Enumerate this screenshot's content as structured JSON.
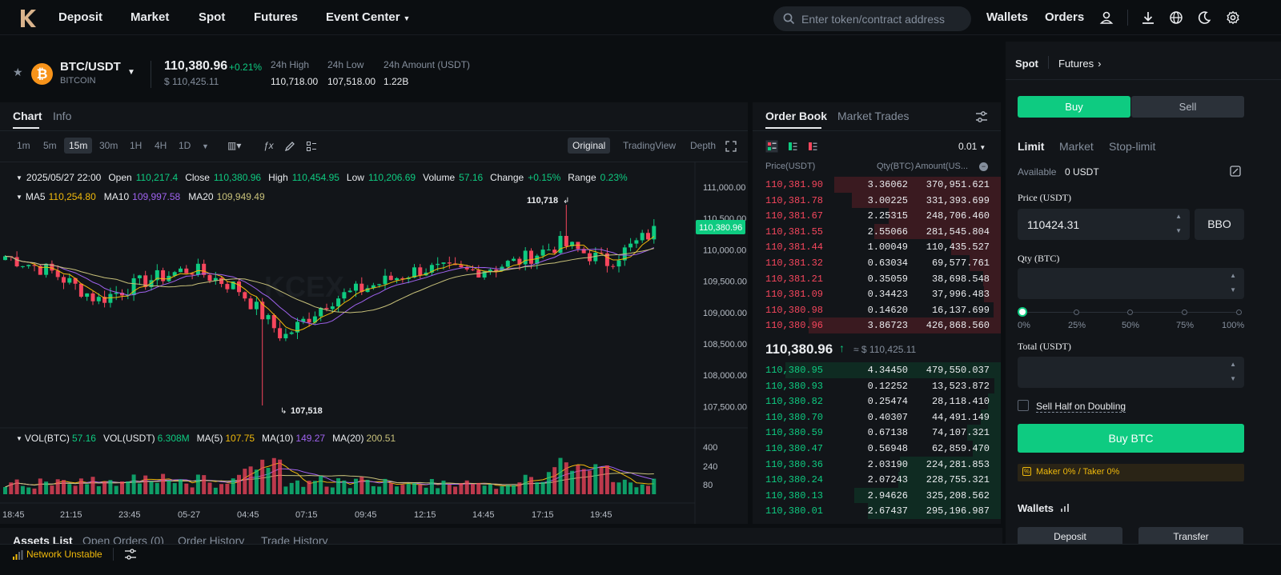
{
  "nav": {
    "links": [
      "Deposit",
      "Market",
      "Spot",
      "Futures",
      "Event Center"
    ],
    "search_placeholder": "Enter token/contract address",
    "wallets": "Wallets",
    "orders": "Orders"
  },
  "ticker": {
    "pair": "BTC/USDT",
    "name": "BITCOIN",
    "last": "110,380.96",
    "change": "+0.21%",
    "usd": "$ 110,425.11",
    "high_label": "24h High",
    "high": "110,718.00",
    "low_label": "24h Low",
    "low": "107,518.00",
    "amount_label": "24h Amount (USDT)",
    "amount": "1.22B"
  },
  "chart_panel": {
    "tabs": [
      "Chart",
      "Info"
    ],
    "timeframes": [
      "1m",
      "5m",
      "15m",
      "30m",
      "1H",
      "4H",
      "1D"
    ],
    "selected_timeframe": "15m",
    "views": [
      "Original",
      "TradingView",
      "Depth"
    ],
    "ohlc": {
      "date": "2025/05/27 22:00",
      "open_label": "Open",
      "open": "110,217.4",
      "close_label": "Close",
      "close": "110,380.96",
      "high_label": "High",
      "high": "110,454.95",
      "low_label": "Low",
      "low": "110,206.69",
      "volume_label": "Volume",
      "volume": "57.16",
      "change_label": "Change",
      "change": "+0.15%",
      "range_label": "Range",
      "range": "0.23%"
    },
    "ma": {
      "ma5_label": "MA5",
      "ma5": "110,254.80",
      "ma10_label": "MA10",
      "ma10": "109,997.58",
      "ma20_label": "MA20",
      "ma20": "109,949.49"
    },
    "vol": {
      "vol_btc_label": "VOL(BTC)",
      "vol_btc": "57.16",
      "vol_usdt_label": "VOL(USDT)",
      "vol_usdt": "6.308M",
      "ma5_label": "MA(5)",
      "ma5": "107.75",
      "ma10_label": "MA(10)",
      "ma10": "149.27",
      "ma20_label": "MA(20)",
      "ma20": "200.51"
    },
    "price_axis": [
      "111,000.00",
      "110,500.00",
      "110,000.00",
      "109,500.00",
      "109,000.00",
      "108,500.00",
      "108,000.00",
      "107,500.00"
    ],
    "vol_axis": [
      "400",
      "240",
      "80"
    ],
    "time_axis": [
      "18:45",
      "21:15",
      "23:45",
      "05-27",
      "04:45",
      "07:15",
      "09:45",
      "12:15",
      "14:45",
      "17:15",
      "19:45"
    ],
    "current_price_tag": "110,380.96",
    "high_marker": "110,718",
    "low_marker": "107,518",
    "watermark": "KCEX"
  },
  "orderbook": {
    "tabs": [
      "Order Book",
      "Market Trades"
    ],
    "precision": "0.01",
    "headers": [
      "Price(USDT)",
      "Qty(BTC)",
      "Amount(US..."
    ],
    "asks": [
      [
        "110,381.90",
        "3.36062",
        "370,951.621"
      ],
      [
        "110,381.78",
        "3.00225",
        "331,393.699"
      ],
      [
        "110,381.67",
        "2.25315",
        "248,706.460"
      ],
      [
        "110,381.55",
        "2.55066",
        "281,545.804"
      ],
      [
        "110,381.44",
        "1.00049",
        "110,435.527"
      ],
      [
        "110,381.32",
        "0.63034",
        "69,577.761"
      ],
      [
        "110,381.21",
        "0.35059",
        "38,698.548"
      ],
      [
        "110,381.09",
        "0.34423",
        "37,996.483"
      ],
      [
        "110,380.98",
        "0.14620",
        "16,137.699"
      ],
      [
        "110,380.96",
        "3.86723",
        "426,868.560"
      ]
    ],
    "mid_price": "110,380.96",
    "mid_usd": "≈ $ 110,425.11",
    "bids": [
      [
        "110,380.95",
        "4.34450",
        "479,550.037"
      ],
      [
        "110,380.93",
        "0.12252",
        "13,523.872"
      ],
      [
        "110,380.82",
        "0.25474",
        "28,118.410"
      ],
      [
        "110,380.70",
        "0.40307",
        "44,491.149"
      ],
      [
        "110,380.59",
        "0.67138",
        "74,107.321"
      ],
      [
        "110,380.47",
        "0.56948",
        "62,859.470"
      ],
      [
        "110,380.36",
        "2.03190",
        "224,281.853"
      ],
      [
        "110,380.24",
        "2.07243",
        "228,755.321"
      ],
      [
        "110,380.13",
        "2.94626",
        "325,208.562"
      ],
      [
        "110,380.01",
        "2.67437",
        "295,196.987"
      ]
    ]
  },
  "trade": {
    "tabs": [
      "Spot",
      "Futures"
    ],
    "buy": "Buy",
    "sell": "Sell",
    "order_types": [
      "Limit",
      "Market",
      "Stop-limit"
    ],
    "available_label": "Available",
    "available": "0 USDT",
    "price_label": "Price (USDT)",
    "price_value": "110424.31",
    "bbo": "BBO",
    "qty_label": "Qty (BTC)",
    "slider_marks": [
      "0%",
      "25%",
      "50%",
      "75%",
      "100%"
    ],
    "slider_value": 0,
    "total_label": "Total (USDT)",
    "sell_half": "Sell Half on Doubling",
    "submit": "Buy BTC",
    "fee": "Maker 0% / Taker 0%",
    "wallets_title": "Wallets",
    "deposit": "Deposit",
    "transfer": "Transfer"
  },
  "bottom": {
    "tabs": [
      "Assets List",
      "Open Orders (0)",
      "Order History",
      "Trade History"
    ],
    "network": "Network Unstable"
  },
  "colors": {
    "green": "#0ecb81",
    "red": "#f6465d",
    "ma5": "#f0b90b",
    "ma10": "#a063f0",
    "ma20": "#c8c17a",
    "bg": "#0b0e11",
    "panel": "#121519"
  },
  "chart_data": {
    "type": "candlestick",
    "x": [
      "18:45",
      "21:15",
      "23:45",
      "05-27",
      "04:45",
      "07:15",
      "09:45",
      "12:15",
      "14:45",
      "17:15",
      "19:45"
    ],
    "close": [
      109900,
      109650,
      109200,
      109500,
      109700,
      109400,
      108600,
      109200,
      109450,
      109700,
      109650,
      109800,
      110100,
      109800,
      110300
    ],
    "high_marker": 110718,
    "low_marker": 107518,
    "last": 110380.96,
    "ylim": [
      107300,
      111150
    ]
  }
}
